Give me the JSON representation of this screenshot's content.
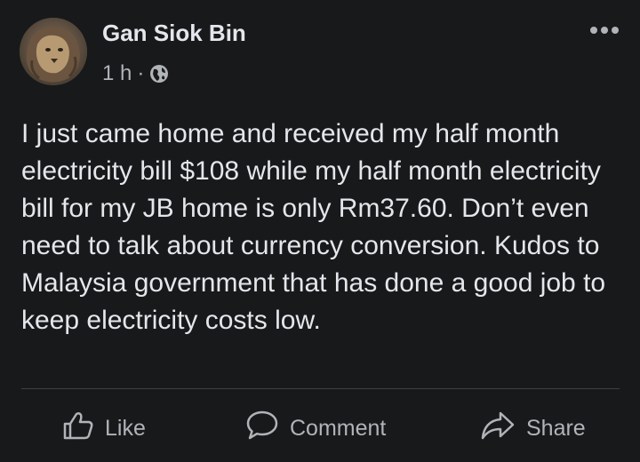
{
  "post": {
    "author": "Gan Siok Bin",
    "time": "1 h",
    "separator": "·",
    "privacy_icon": "globe-icon",
    "more_icon": "more-options-icon",
    "body": "I just came home and received my half month electricity bill $108 while my half month electricity bill for my JB home is only Rm37.60. Don’t even need to talk about currency conversion. Kudos to Malaysia government that has done a good job to keep electricity costs low."
  },
  "actions": {
    "like_label": "Like",
    "comment_label": "Comment",
    "share_label": "Share"
  },
  "colors": {
    "background": "#18191a",
    "primary_text": "#e4e6eb",
    "secondary_text": "#b0b3b8",
    "divider": "#3e4042"
  }
}
